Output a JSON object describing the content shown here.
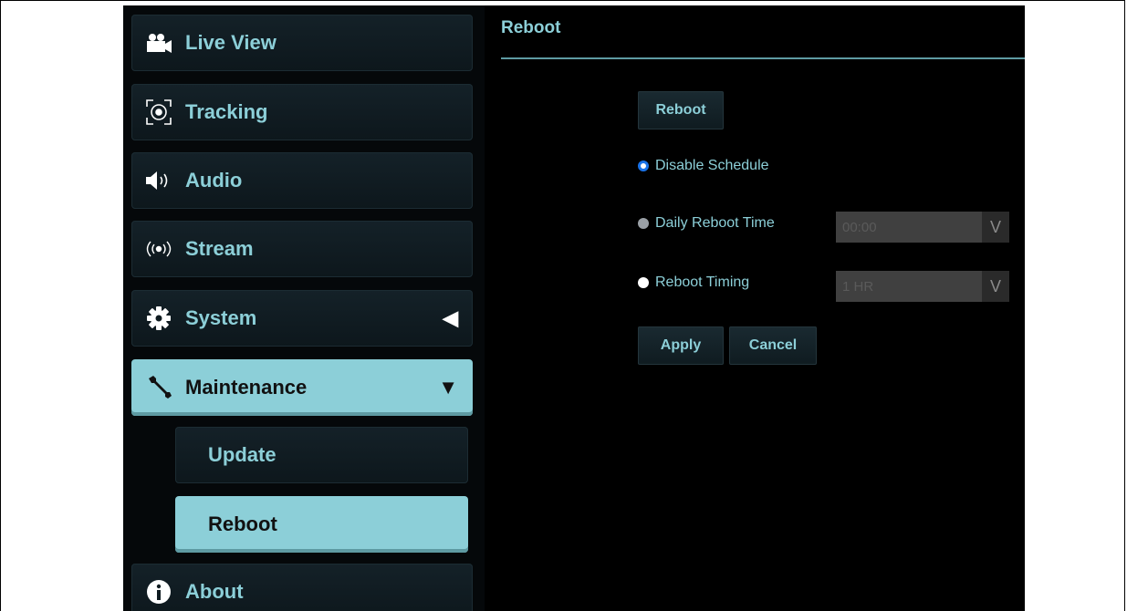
{
  "sidebar": {
    "items": [
      {
        "label": "Live View",
        "icon": "video-camera-icon"
      },
      {
        "label": "Tracking",
        "icon": "tracking-target-icon"
      },
      {
        "label": "Audio",
        "icon": "speaker-icon"
      },
      {
        "label": "Stream",
        "icon": "broadcast-icon"
      },
      {
        "label": "System",
        "icon": "gear-icon",
        "arrow": "◀"
      },
      {
        "label": "Maintenance",
        "icon": "wrench-icon",
        "arrow": "▼"
      },
      {
        "label": "About",
        "icon": "info-icon"
      }
    ],
    "subitems": [
      {
        "label": "Update"
      },
      {
        "label": "Reboot"
      }
    ]
  },
  "main": {
    "title": "Reboot",
    "reboot_button": "Reboot",
    "options": [
      {
        "label": "Disable Schedule",
        "state": "checked"
      },
      {
        "label": "Daily Reboot Time",
        "state": "disabled"
      },
      {
        "label": "Reboot Timing",
        "state": "unchecked"
      }
    ],
    "daily_time_select": {
      "value": "00:00",
      "chevron": "V"
    },
    "timing_select": {
      "value": "1 HR",
      "chevron": "V"
    },
    "apply_label": "Apply",
    "cancel_label": "Cancel"
  },
  "colors": {
    "accent": "#8ccfd8",
    "background": "#000000",
    "radio_checked": "#1a73e8"
  }
}
